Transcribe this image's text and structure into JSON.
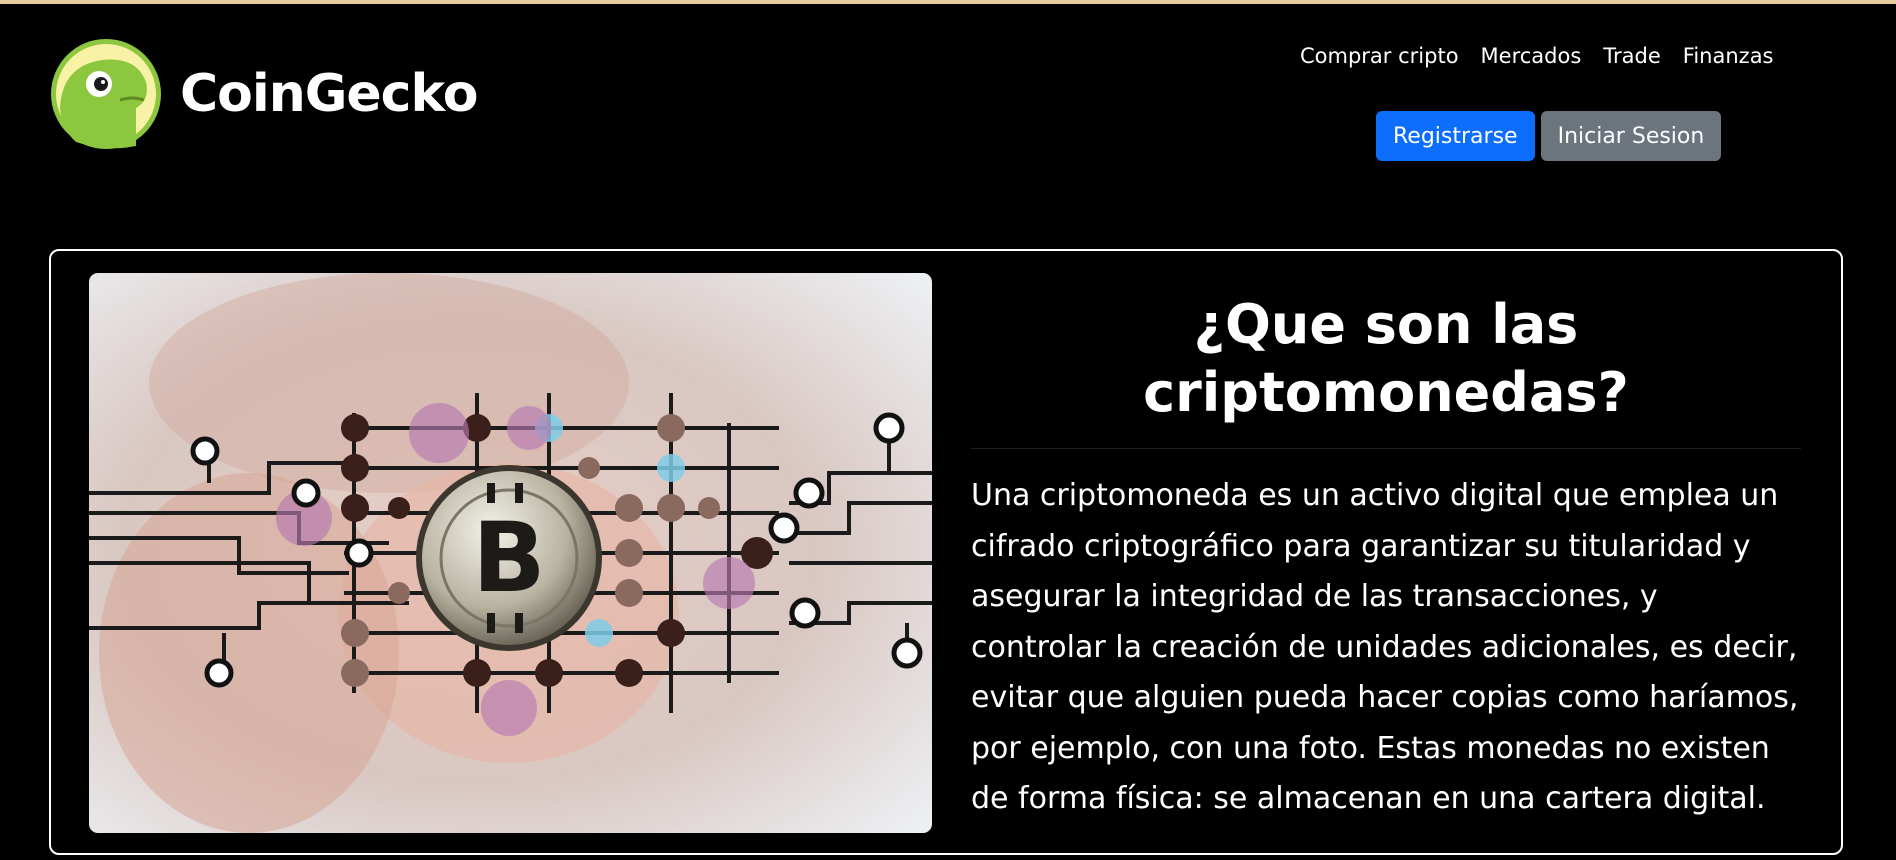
{
  "brand": {
    "name": "CoinGecko",
    "logo_icon": "gecko-icon",
    "colors": {
      "accent": "#8dc63f",
      "background": "#000000"
    }
  },
  "nav": {
    "items": [
      {
        "label": "Comprar cripto"
      },
      {
        "label": "Mercados"
      },
      {
        "label": "Trade"
      },
      {
        "label": "Finanzas"
      }
    ]
  },
  "auth": {
    "register_label": "Registrarse",
    "login_label": "Iniciar Sesion",
    "register_color": "#0d6efd",
    "login_color": "#6c757d"
  },
  "article": {
    "image_icon": "bitcoin-circuit-image",
    "title": "¿Que son las criptomonedas?",
    "body": "Una criptomoneda es un activo digital que emplea un cifrado criptográfico para garantizar su titularidad y asegurar la integridad de las transacciones, y controlar la creación de unidades adicionales, es decir, evitar que alguien pueda hacer copias como haríamos, por ejemplo, con una foto. Estas monedas no existen de forma física: se almacenan en una cartera digital."
  }
}
